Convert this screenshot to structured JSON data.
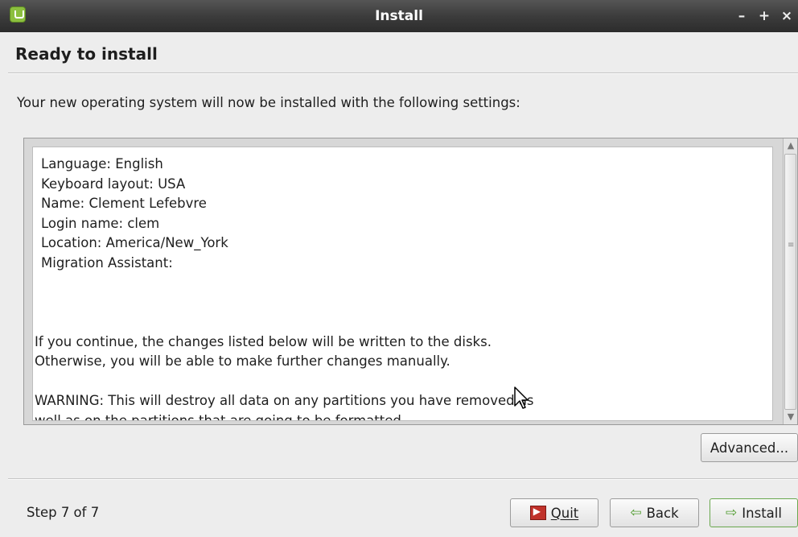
{
  "window": {
    "title": "Install",
    "controls": [
      "–",
      "+",
      "×"
    ]
  },
  "page": {
    "title": "Ready to install",
    "subtitle": "Your new operating system will now be installed with the following settings:"
  },
  "summary": {
    "lines": [
      "Language: English",
      "Keyboard layout: USA",
      "Name: Clement Lefebvre",
      "Login name: clem",
      "Location: America/New_York",
      "Migration Assistant:"
    ],
    "continue_lines": [
      "If you continue, the changes listed below will be written to the disks.",
      "Otherwise, you will be able to make further changes manually."
    ],
    "warning_lines": [
      "WARNING: This will destroy all data on any partitions you have removed as",
      "well as on the partitions that are going to be formatted."
    ]
  },
  "buttons": {
    "advanced": "Advanced...",
    "quit": "Quit",
    "back": "Back",
    "install": "Install"
  },
  "footer": {
    "step": "Step 7 of 7"
  },
  "icons": {
    "app": "linux-mint-icon",
    "quit": "quit-icon",
    "back": "arrow-left-icon",
    "install": "arrow-right-icon"
  },
  "colors": {
    "titlebar": "#3c3c3c",
    "install_border": "#6aa84f",
    "arrow_green": "#4e9a2d"
  }
}
